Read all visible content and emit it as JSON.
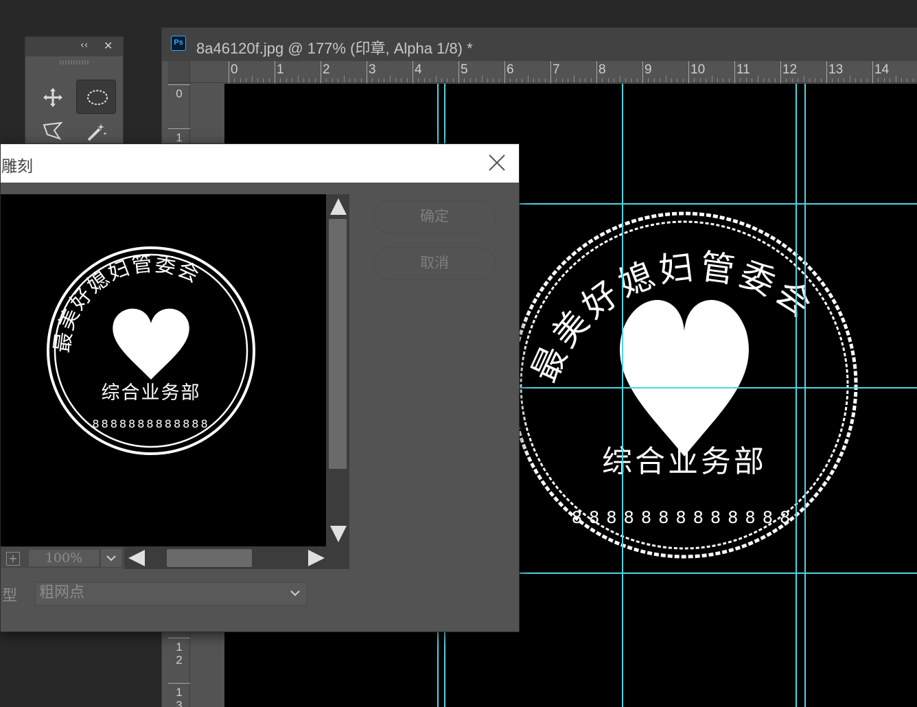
{
  "document": {
    "title": "8a46120f.jpg @ 177% (印章, Alpha 1/8) *",
    "app_icon": "Ps",
    "ruler_h": [
      "0",
      "1",
      "2",
      "3",
      "4",
      "5",
      "6",
      "7",
      "8",
      "9",
      "10",
      "11",
      "12",
      "13",
      "14"
    ],
    "ruler_v": [
      "0",
      "1",
      "1\n2",
      "1\n3"
    ]
  },
  "tools": {
    "collapse": "‹‹",
    "close": "✕",
    "icons": [
      "move-icon",
      "elliptical-marquee-icon",
      "polygonal-lasso-icon",
      "magic-wand-icon"
    ]
  },
  "dialog": {
    "title": "版雕刻",
    "ok_label": "确定",
    "cancel_label": "取消",
    "zoom_value": "100%",
    "zoom_plus": "+",
    "type_label": "型",
    "type_value": "粗网点"
  },
  "stamp": {
    "arc_text": "最美好媳妇管委会",
    "dept_text": "综合业务部",
    "number_text": "8888888888888"
  },
  "colors": {
    "guide": "#4ed6e4",
    "panel": "#535353",
    "ps_blue": "#31a8ff"
  }
}
